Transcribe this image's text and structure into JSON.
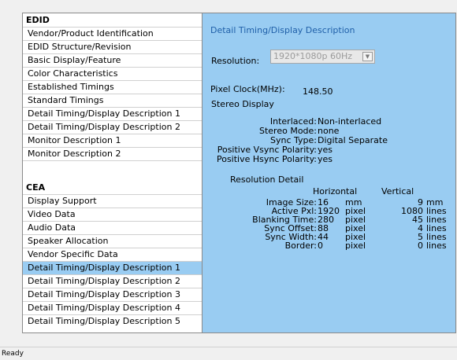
{
  "sidebar": {
    "edid_header": "EDID",
    "edid_items": [
      "Vendor/Product Identification",
      "EDID Structure/Revision",
      "Basic Display/Feature",
      "Color Characteristics",
      "Established Timings",
      "Standard Timings",
      "Detail Timing/Display Description 1",
      "Detail Timing/Display Description 2",
      "Monitor Description 1",
      "Monitor Description 2"
    ],
    "cea_header": "CEA",
    "cea_items": [
      "Display Support",
      "Video Data",
      "Audio Data",
      "Speaker Allocation",
      "Vendor Specific Data",
      "Detail Timing/Display Description 1",
      "Detail Timing/Display Description 2",
      "Detail Timing/Display Description 3",
      "Detail Timing/Display Description 4",
      "Detail Timing/Display Description 5"
    ],
    "selected_cea_index": 5
  },
  "detail": {
    "title": "Detail Timing/Display Description",
    "resolution_label": "Resolution:",
    "resolution_value": "1920*1080p 60Hz",
    "pixel_clock_label": "Pixel Clock(MHz):",
    "pixel_clock_value": "148.50",
    "stereo_header": "Stereo Display",
    "stereo": [
      {
        "label": "Interlaced:",
        "value": "Non-interlaced"
      },
      {
        "label": "Stereo Mode:",
        "value": "none"
      },
      {
        "label": "Sync Type:",
        "value": "Digital Separate"
      },
      {
        "label": "Positive Vsync Polarity:",
        "value": "yes"
      },
      {
        "label": "Positive Hsync Polarity:",
        "value": "yes"
      }
    ],
    "res_detail_header": "Resolution Detail",
    "col_horizontal": "Horizontal",
    "col_vertical": "Vertical",
    "rows": [
      {
        "label": "Image Size:",
        "h": "16",
        "h_unit": "mm",
        "v": "9",
        "v_unit": "mm"
      },
      {
        "label": "Active Pxl:",
        "h": "1920",
        "h_unit": "pixel",
        "v": "1080",
        "v_unit": "lines"
      },
      {
        "label": "Blanking Time:",
        "h": "280",
        "h_unit": "pixel",
        "v": "45",
        "v_unit": "lines"
      },
      {
        "label": "Sync Offset:",
        "h": "88",
        "h_unit": "pixel",
        "v": "4",
        "v_unit": "lines"
      },
      {
        "label": "Sync Width:",
        "h": "44",
        "h_unit": "pixel",
        "v": "5",
        "v_unit": "lines"
      },
      {
        "label": "Border:",
        "h": "0",
        "h_unit": "pixel",
        "v": "0",
        "v_unit": "lines"
      }
    ]
  },
  "status": "Ready",
  "colors": {
    "panel_bg": "#99ccf2",
    "selected_bg": "#99ccf2",
    "title_color": "#1f5fa8"
  }
}
